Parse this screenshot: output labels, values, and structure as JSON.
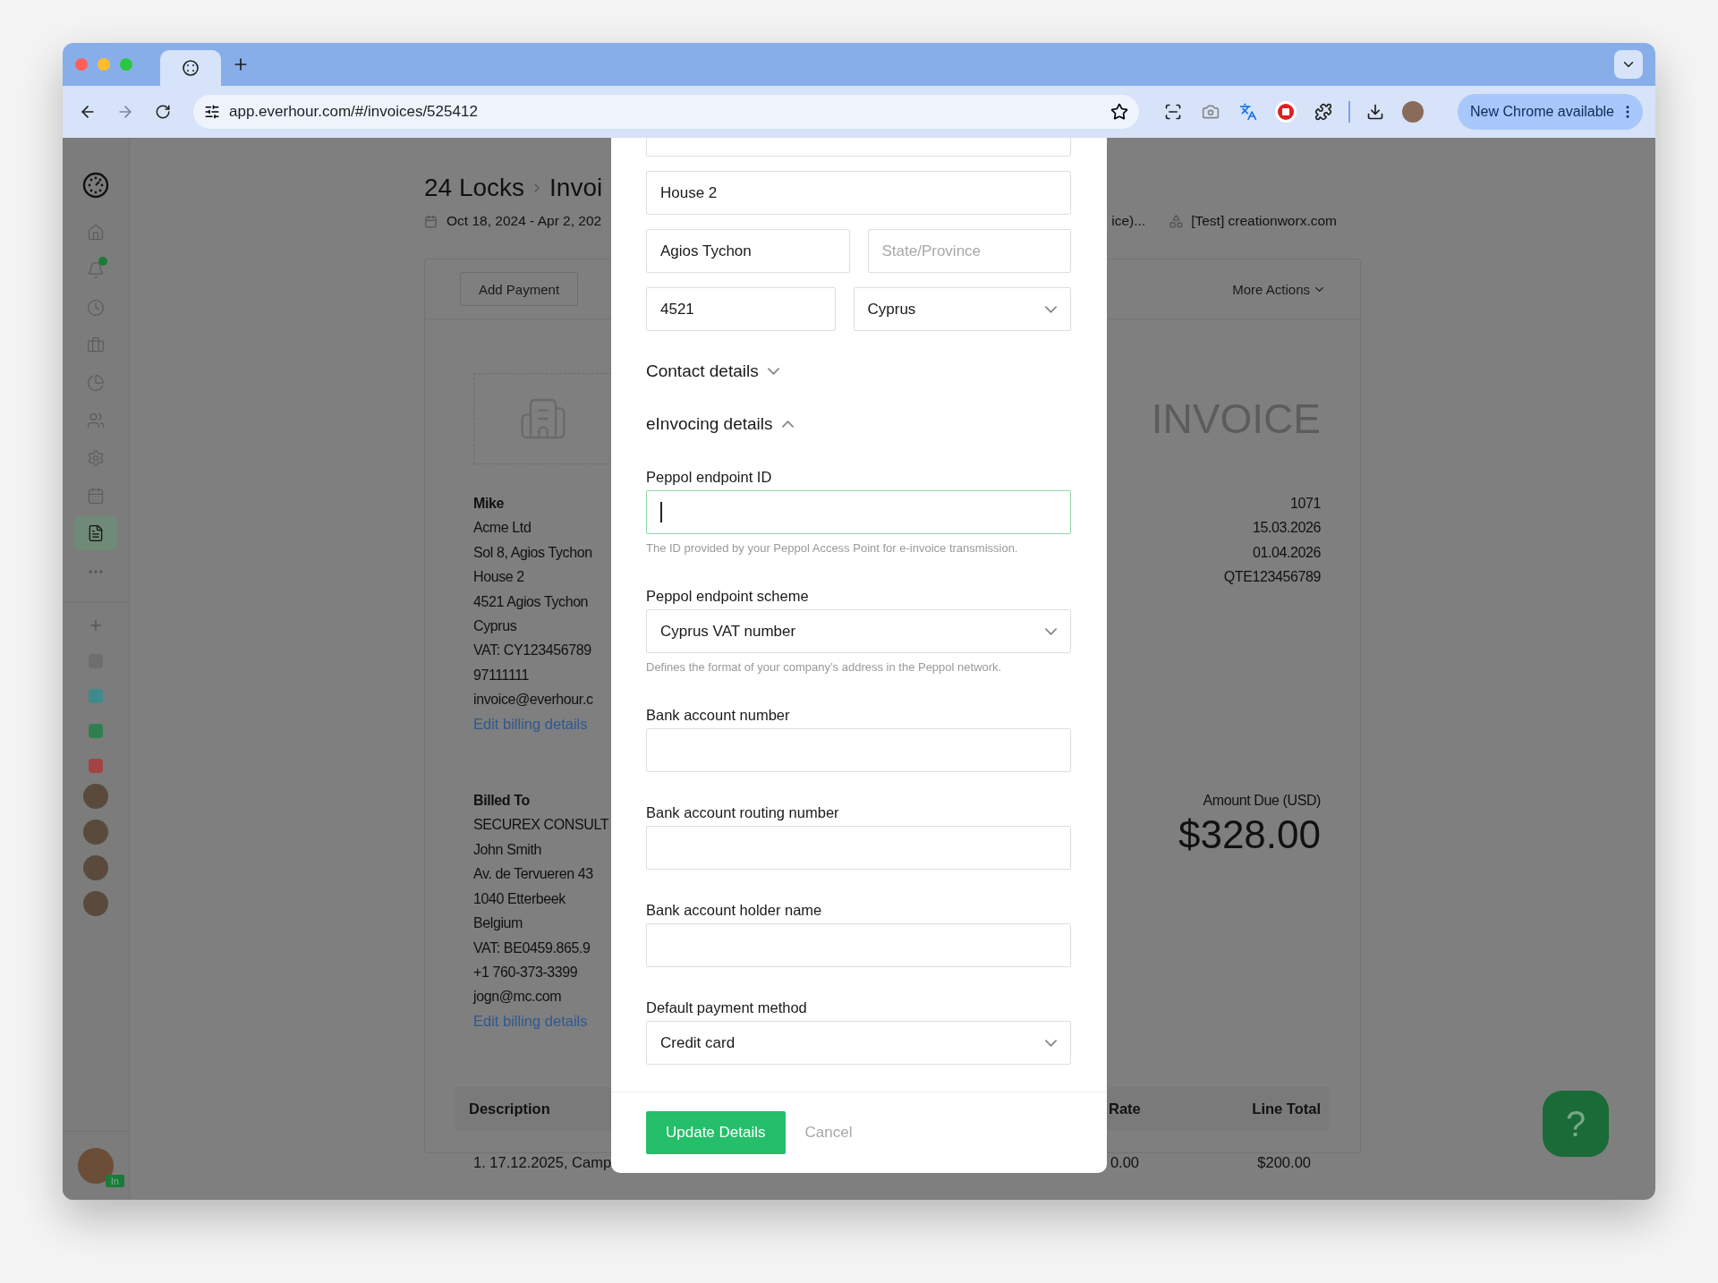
{
  "browser": {
    "url": "app.everhour.com/#/invoices/525412",
    "update_button": "New Chrome available"
  },
  "sidebar": {
    "nav": [
      {
        "kind": "home",
        "selected": false,
        "notification": false
      },
      {
        "kind": "bell",
        "selected": false,
        "notification": true
      },
      {
        "kind": "clock",
        "selected": false,
        "notification": false
      },
      {
        "kind": "briefcase",
        "selected": false,
        "notification": false
      },
      {
        "kind": "pie",
        "selected": false,
        "notification": false
      },
      {
        "kind": "people",
        "selected": false,
        "notification": false
      },
      {
        "kind": "gear",
        "selected": false,
        "notification": false
      },
      {
        "kind": "calendar",
        "selected": false,
        "notification": false
      },
      {
        "kind": "invoice",
        "selected": true,
        "notification": false
      }
    ],
    "projects": [
      {
        "color": "#6e6e6e"
      },
      {
        "color": "#3f8a8c"
      },
      {
        "color": "#2f8050"
      },
      {
        "color": "#a34444"
      }
    ],
    "user_badge": "In"
  },
  "page": {
    "breadcrumb": [
      "24 Locks",
      "Invoi"
    ],
    "date_range": "Oct 18, 2024 - Apr 2, 202",
    "project": "ice)...",
    "client": "[Test] creationworx.com"
  },
  "invoice": {
    "actions": [
      "Add Payment"
    ],
    "more_actions": "More Actions",
    "heading": "INVOICE",
    "sender": {
      "lines": [
        "Mike",
        "Acme Ltd",
        "Sol 8, Agios Tychon",
        "House 2",
        "4521 Agios Tychon",
        "Cyprus",
        "VAT: CY123456789",
        "97111111",
        "invoice@everhour.c"
      ],
      "link": "Edit billing details"
    },
    "meta": [
      "1071",
      "15.03.2026",
      "01.04.2026",
      "QTE123456789"
    ],
    "billed_to": {
      "heading": "Billed To",
      "lines": [
        "SECUREX CONSULT",
        "John Smith",
        "Av. de Tervueren 43",
        "1040 Etterbeek",
        "Belgium",
        "VAT: BE0459.865.9",
        "+1 760-373-3399",
        "jogn@mc.com"
      ],
      "link": "Edit billing details"
    },
    "amount_due": {
      "label": "Amount Due (USD)",
      "value": "$328.00"
    },
    "table": {
      "columns": [
        "Description",
        "Rate",
        "Line Total"
      ],
      "rows": [
        [
          "1. 17.12.2025, Camp",
          "0.00",
          "$200.00"
        ]
      ]
    }
  },
  "modal": {
    "address_rows": [
      [
        {
          "kind": "input"
        }
      ],
      [
        {
          "kind": "input",
          "value": "House 2"
        }
      ],
      [
        {
          "kind": "input",
          "value": "Agios Tychon"
        },
        {
          "kind": "input",
          "placeholder": "State/Province"
        }
      ],
      [
        {
          "kind": "input",
          "value": "4521"
        },
        {
          "kind": "select",
          "value": "Cyprus"
        }
      ]
    ],
    "sections": [
      {
        "title": "Contact details",
        "expanded": false
      },
      {
        "title": "eInvocing details",
        "expanded": true
      }
    ],
    "fields": [
      {
        "label": "Peppol endpoint ID",
        "kind": "input",
        "focused": true,
        "hint": "The ID provided by your Peppol Access Point for e-invoice transmission."
      },
      {
        "label": "Peppol endpoint scheme",
        "kind": "select",
        "focused": false,
        "value": "Cyprus VAT number",
        "hint": "Defines the format of your company’s address in the Peppol network."
      },
      {
        "label": "Bank account number",
        "kind": "input",
        "focused": false
      },
      {
        "label": "Bank account routing number",
        "kind": "input",
        "focused": false
      },
      {
        "label": "Bank account holder name",
        "kind": "input",
        "focused": false
      },
      {
        "label": "Default payment method",
        "kind": "select",
        "focused": false,
        "value": "Credit card"
      }
    ],
    "submit": "Update Details",
    "cancel": "Cancel"
  },
  "help": "?"
}
